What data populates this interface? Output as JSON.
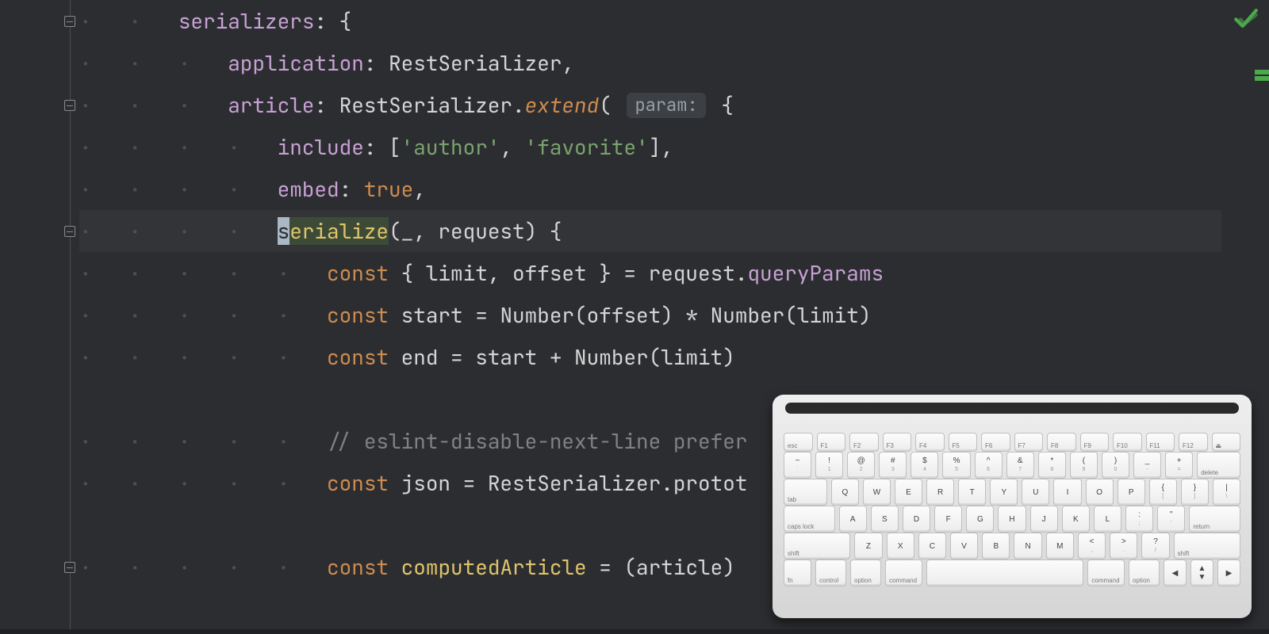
{
  "ide": {
    "theme": "dark",
    "inspection_status": "ok"
  },
  "folds": [
    {
      "line": 0
    },
    {
      "line": 2
    },
    {
      "line": 5
    },
    {
      "line": 13
    }
  ],
  "intention_bulb_line": 5,
  "minimap_marks": [
    88,
    96
  ],
  "code_lines": [
    {
      "indent": 2,
      "segments": [
        {
          "t": "prop",
          "v": "serializers"
        },
        {
          "t": "punct",
          "v": ": {"
        }
      ]
    },
    {
      "indent": 3,
      "segments": [
        {
          "t": "prop",
          "v": "application"
        },
        {
          "t": "punct",
          "v": ": "
        },
        {
          "t": "ident",
          "v": "RestSerializer"
        },
        {
          "t": "punct",
          "v": ","
        }
      ]
    },
    {
      "indent": 3,
      "segments": [
        {
          "t": "prop",
          "v": "article"
        },
        {
          "t": "punct",
          "v": ": "
        },
        {
          "t": "ident",
          "v": "RestSerializer"
        },
        {
          "t": "punct",
          "v": "."
        },
        {
          "t": "call",
          "v": "extend"
        },
        {
          "t": "punct",
          "v": "( "
        },
        {
          "t": "hint",
          "v": "param:"
        },
        {
          "t": "punct",
          "v": " {"
        }
      ]
    },
    {
      "indent": 4,
      "segments": [
        {
          "t": "prop",
          "v": "include"
        },
        {
          "t": "punct",
          "v": ": ["
        },
        {
          "t": "str",
          "v": "'author'"
        },
        {
          "t": "punct",
          "v": ", "
        },
        {
          "t": "str",
          "v": "'favorite'"
        },
        {
          "t": "punct",
          "v": "],"
        }
      ]
    },
    {
      "indent": 4,
      "segments": [
        {
          "t": "prop",
          "v": "embed"
        },
        {
          "t": "punct",
          "v": ": "
        },
        {
          "t": "bool",
          "v": "true"
        },
        {
          "t": "punct",
          "v": ","
        }
      ]
    },
    {
      "indent": 4,
      "highlight": true,
      "cursor": true,
      "segments": [
        {
          "t": "method",
          "v": "serialize"
        },
        {
          "t": "punct",
          "v": "(_, request) {"
        }
      ]
    },
    {
      "indent": 5,
      "segments": [
        {
          "t": "def",
          "v": "const"
        },
        {
          "t": "punct",
          "v": " { limit, offset } = request."
        },
        {
          "t": "member",
          "v": "queryParams"
        }
      ]
    },
    {
      "indent": 5,
      "segments": [
        {
          "t": "def",
          "v": "const"
        },
        {
          "t": "punct",
          "v": " start = "
        },
        {
          "t": "ident",
          "v": "Number"
        },
        {
          "t": "punct",
          "v": "(offset) * "
        },
        {
          "t": "ident",
          "v": "Number"
        },
        {
          "t": "punct",
          "v": "(limit)"
        }
      ]
    },
    {
      "indent": 5,
      "segments": [
        {
          "t": "def",
          "v": "const"
        },
        {
          "t": "punct",
          "v": " end = start + "
        },
        {
          "t": "ident",
          "v": "Number"
        },
        {
          "t": "punct",
          "v": "(limit)"
        }
      ]
    },
    {
      "indent": 0,
      "segments": []
    },
    {
      "indent": 5,
      "segments": [
        {
          "t": "comment",
          "v": "// eslint-disable-next-line prefer"
        }
      ]
    },
    {
      "indent": 5,
      "segments": [
        {
          "t": "def",
          "v": "const"
        },
        {
          "t": "punct",
          "v": " json = RestSerializer.protot"
        }
      ]
    },
    {
      "indent": 0,
      "segments": []
    },
    {
      "indent": 5,
      "segments": [
        {
          "t": "def",
          "v": "const"
        },
        {
          "t": "punct",
          "v": " "
        },
        {
          "t": "method",
          "v": "computedArticle"
        },
        {
          "t": "punct",
          "v": " = (article)"
        }
      ]
    }
  ],
  "keyboard": {
    "rows": [
      [
        "esc",
        "F1",
        "F2",
        "F3",
        "F4",
        "F5",
        "F6",
        "F7",
        "F8",
        "F9",
        "F10",
        "F11",
        "F12",
        "⏏"
      ],
      [
        [
          "~",
          "`"
        ],
        [
          "!",
          "1"
        ],
        [
          "@",
          "2"
        ],
        [
          "#",
          "3"
        ],
        [
          "$",
          "4"
        ],
        [
          "%",
          "5"
        ],
        [
          "^",
          "6"
        ],
        [
          "&",
          "7"
        ],
        [
          "*",
          "8"
        ],
        [
          "(",
          "9"
        ],
        [
          ")",
          "0"
        ],
        [
          "_",
          "-"
        ],
        [
          "+",
          "="
        ],
        "delete"
      ],
      [
        "tab",
        "Q",
        "W",
        "E",
        "R",
        "T",
        "Y",
        "U",
        "I",
        "O",
        "P",
        [
          "{",
          "["
        ],
        [
          "}",
          "]"
        ],
        [
          "|",
          "\\"
        ]
      ],
      [
        "caps lock",
        "A",
        "S",
        "D",
        "F",
        "G",
        "H",
        "J",
        "K",
        "L",
        [
          ":",
          ";"
        ],
        [
          "\"",
          "'"
        ],
        "return"
      ],
      [
        "shift",
        "Z",
        "X",
        "C",
        "V",
        "B",
        "N",
        "M",
        [
          "<",
          ","
        ],
        [
          ">",
          "."
        ],
        [
          "?",
          "/"
        ],
        "shift"
      ],
      [
        "fn",
        "control",
        "option",
        "command",
        "",
        "command",
        "option",
        "◀",
        "▲▼",
        "▶"
      ]
    ]
  }
}
